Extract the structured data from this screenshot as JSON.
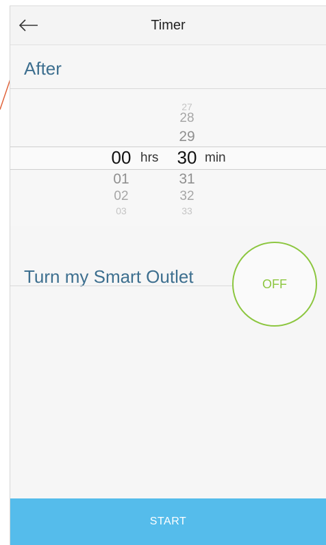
{
  "header": {
    "title": "Timer",
    "back_icon": "arrow-left-icon"
  },
  "after_label": "After",
  "picker": {
    "hours": {
      "unit": "hrs",
      "selected": "00",
      "above": [],
      "below": [
        "01",
        "02",
        "03"
      ]
    },
    "minutes": {
      "unit": "min",
      "selected": "30",
      "above": [
        "27",
        "28",
        "29"
      ],
      "below": [
        "31",
        "32",
        "33"
      ]
    }
  },
  "outlet_label": "Turn my Smart Outlet",
  "toggle": {
    "state": "OFF",
    "color": "#8cc63f"
  },
  "start_button": {
    "label": "START",
    "color": "#55bceb"
  },
  "colors": {
    "label": "#3d6f8f",
    "annotation": "#e0633a"
  }
}
